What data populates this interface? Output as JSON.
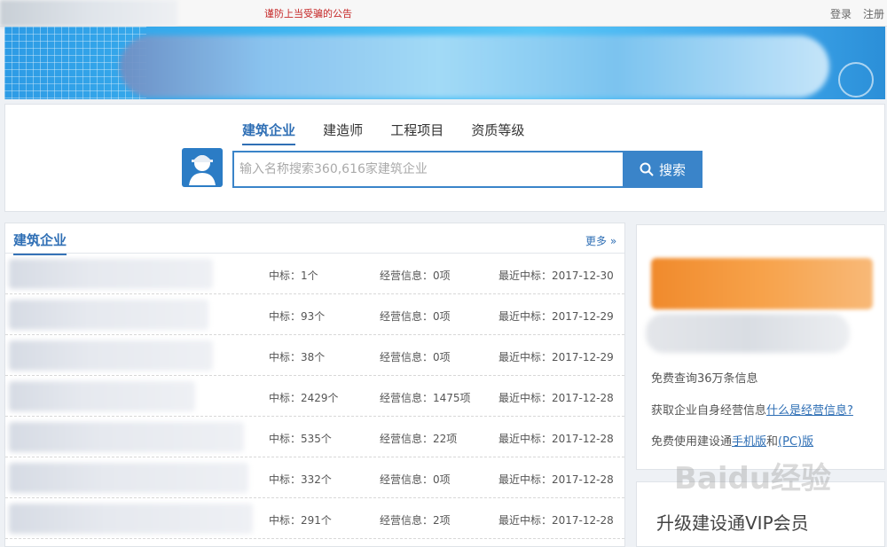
{
  "topbar": {
    "notice": "谨防上当受骗的公告",
    "login": "登录",
    "register": "注册"
  },
  "search": {
    "tabs": [
      {
        "label": "建筑企业",
        "active": true
      },
      {
        "label": "建造师",
        "active": false
      },
      {
        "label": "工程项目",
        "active": false
      },
      {
        "label": "资质等级",
        "active": false
      }
    ],
    "placeholder": "输入名称搜索360,616家建筑企业",
    "button_label": "搜索"
  },
  "list": {
    "title": "建筑企业",
    "more": "更多 »",
    "rows": [
      {
        "bid": "中标：1个",
        "ops": "经营信息：0项",
        "recent": "最近中标：2017-12-30"
      },
      {
        "bid": "中标：93个",
        "ops": "经营信息：0项",
        "recent": "最近中标：2017-12-29"
      },
      {
        "bid": "中标：38个",
        "ops": "经营信息：0项",
        "recent": "最近中标：2017-12-29"
      },
      {
        "bid": "中标：2429个",
        "ops": "经营信息：1475项",
        "recent": "最近中标：2017-12-28"
      },
      {
        "bid": "中标：535个",
        "ops": "经营信息：22项",
        "recent": "最近中标：2017-12-28"
      },
      {
        "bid": "中标：332个",
        "ops": "经营信息：0项",
        "recent": "最近中标：2017-12-28"
      },
      {
        "bid": "中标：291个",
        "ops": "经营信息：2项",
        "recent": "最近中标：2017-12-28"
      }
    ]
  },
  "side": {
    "line1": "免费查询36万条信息",
    "line2_prefix": "获取企业自身经营信息",
    "line2_link": "什么是经营信息?",
    "line3_prefix": "免费使用建设通",
    "line3_link1": "手机版",
    "line3_mid": "和",
    "line3_link2": "(PC)版"
  },
  "vip": {
    "label": "升级建设通VIP会员"
  },
  "watermark": "Baidu经验",
  "colors": {
    "accent": "#2f6fb5",
    "search_blue": "#3a84c9",
    "notice_red": "#c62828"
  }
}
